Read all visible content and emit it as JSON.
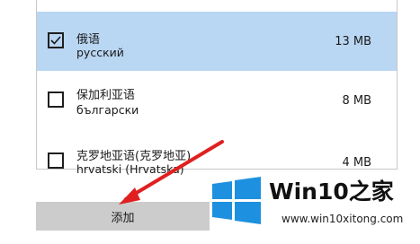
{
  "language_list": {
    "items": [
      {
        "name": "俄语",
        "native": "русский",
        "size": "13 MB",
        "checked": true
      },
      {
        "name": "保加利亚语",
        "native": "български",
        "size": "8 MB",
        "checked": false
      },
      {
        "name": "克罗地亚语(克罗地亚)",
        "native": "hrvatski (Hrvatska)",
        "size": "4 MB",
        "checked": false
      }
    ]
  },
  "add_button": {
    "label": "添加"
  },
  "watermark": {
    "brand": "Win10之家",
    "url": "www.win10xitong.com"
  },
  "colors": {
    "selected_bg": "#b9d6f3",
    "button_bg": "#cccccc",
    "arrow": "#e02020",
    "logo_blue": "#1e90e0"
  },
  "icons": {
    "checkbox_checked": "check-icon",
    "arrow": "red-arrow",
    "logo": "windows-logo-icon"
  }
}
